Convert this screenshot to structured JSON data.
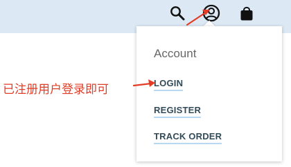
{
  "header": {
    "icons": {
      "search": "search-icon",
      "account": "account-icon",
      "bag": "bag-icon"
    }
  },
  "dropdown": {
    "title": "Account",
    "items": [
      {
        "label": "LOGIN"
      },
      {
        "label": "REGISTER"
      },
      {
        "label": "TRACK ORDER"
      }
    ]
  },
  "annotation": {
    "text": "已注册用户登录即可",
    "color": "#e43b24"
  },
  "colors": {
    "header_background": "#dce9f5",
    "link_text": "#334a58",
    "link_underline": "#b8d8f1",
    "annotation_red": "#e43b24"
  }
}
